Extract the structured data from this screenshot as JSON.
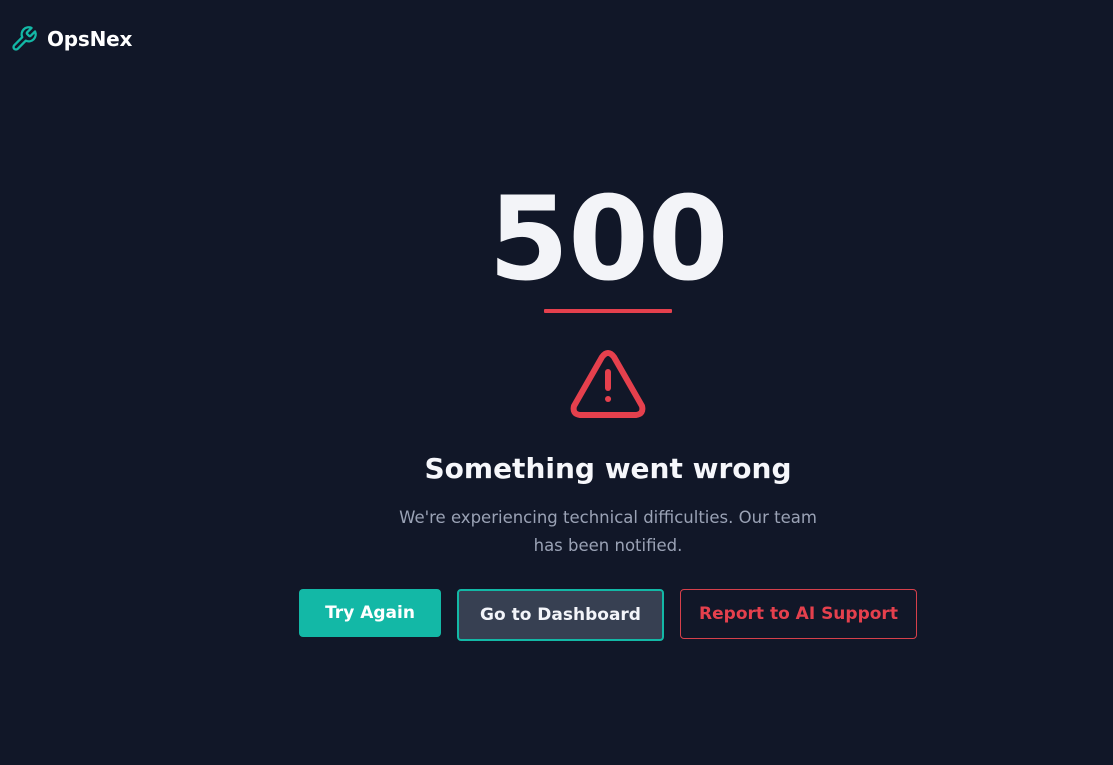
{
  "brand": {
    "name": "OpsNex",
    "icon": "wrench-icon",
    "accent_color": "#13b8a6"
  },
  "error": {
    "code": "500",
    "title": "Something went wrong",
    "message": "We're experiencing technical difficulties. Our team has been notified.",
    "icon": "alert-triangle-icon",
    "accent_color": "#e5404d"
  },
  "actions": {
    "try_again": "Try Again",
    "dashboard": "Go to Dashboard",
    "report": "Report to AI Support"
  },
  "colors": {
    "background": "#111728",
    "primary": "#13b8a6",
    "danger": "#e5404d",
    "secondary_button": "#374052"
  }
}
